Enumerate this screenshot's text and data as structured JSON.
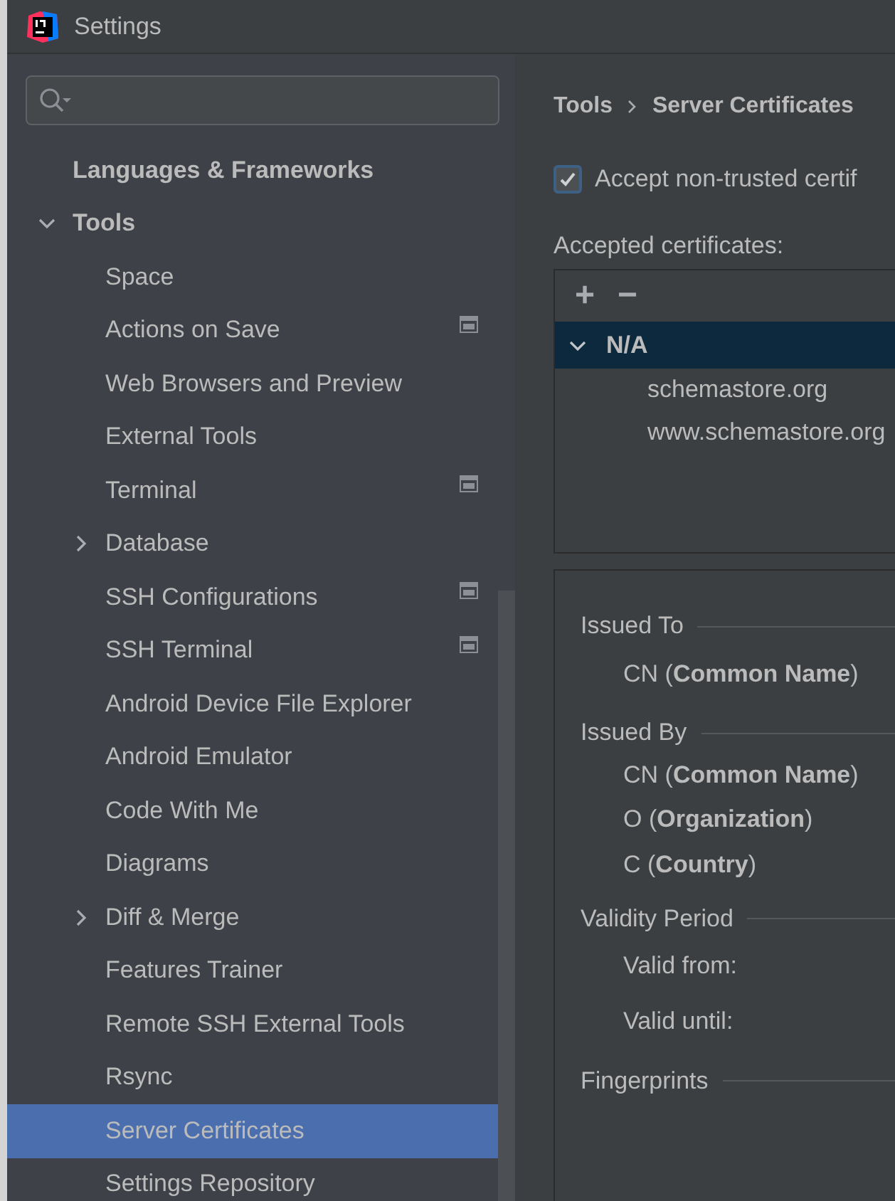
{
  "window": {
    "title": "Settings"
  },
  "sidebar": {
    "items": [
      {
        "label": "Languages & Frameworks",
        "selected": false,
        "per_project": false
      },
      {
        "label": "Tools",
        "expanded": true,
        "selected": false,
        "per_project": false,
        "children": [
          {
            "label": "Space",
            "selected": false,
            "per_project": false
          },
          {
            "label": "Actions on Save",
            "selected": false,
            "per_project": true
          },
          {
            "label": "Web Browsers and Preview",
            "selected": false,
            "per_project": false
          },
          {
            "label": "External Tools",
            "selected": false,
            "per_project": false
          },
          {
            "label": "Terminal",
            "selected": false,
            "per_project": true
          },
          {
            "label": "Database",
            "expanded": false,
            "selected": false,
            "per_project": false
          },
          {
            "label": "SSH Configurations",
            "selected": false,
            "per_project": true
          },
          {
            "label": "SSH Terminal",
            "selected": false,
            "per_project": true
          },
          {
            "label": "Android Device File Explorer",
            "selected": false,
            "per_project": false
          },
          {
            "label": "Android Emulator",
            "selected": false,
            "per_project": false
          },
          {
            "label": "Code With Me",
            "selected": false,
            "per_project": false
          },
          {
            "label": "Diagrams",
            "selected": false,
            "per_project": false
          },
          {
            "label": "Diff & Merge",
            "expanded": false,
            "selected": false,
            "per_project": false
          },
          {
            "label": "Features Trainer",
            "selected": false,
            "per_project": false
          },
          {
            "label": "Remote SSH External Tools",
            "selected": false,
            "per_project": false
          },
          {
            "label": "Rsync",
            "selected": false,
            "per_project": false
          },
          {
            "label": "Server Certificates",
            "selected": true,
            "per_project": false
          },
          {
            "label": "Settings Repository",
            "selected": false,
            "per_project": false
          }
        ]
      }
    ]
  },
  "breadcrumb": [
    "Tools",
    "Server Certificates"
  ],
  "accept_checkbox": {
    "label": "Accept non-trusted certif",
    "checked": true
  },
  "certificates": {
    "label": "Accepted certificates:",
    "toolbar": [
      "+",
      "−"
    ],
    "groups": [
      {
        "label": "N/A",
        "expanded": true,
        "selected": true,
        "children": [
          {
            "label": "schemastore.org"
          },
          {
            "label": "www.schemastore.org"
          }
        ]
      }
    ]
  },
  "details": [
    {
      "title": "Issued To",
      "fields": [
        "CN (**Common Name**)"
      ]
    },
    {
      "title": "Issued By",
      "fields": [
        "CN (**Common Name**)",
        "O (**Organization**)",
        "C (**Country**)"
      ]
    },
    {
      "title": "Validity Period",
      "fields": [
        "Valid from:",
        "Valid until:"
      ]
    },
    {
      "title": "Fingerprints"
    }
  ]
}
